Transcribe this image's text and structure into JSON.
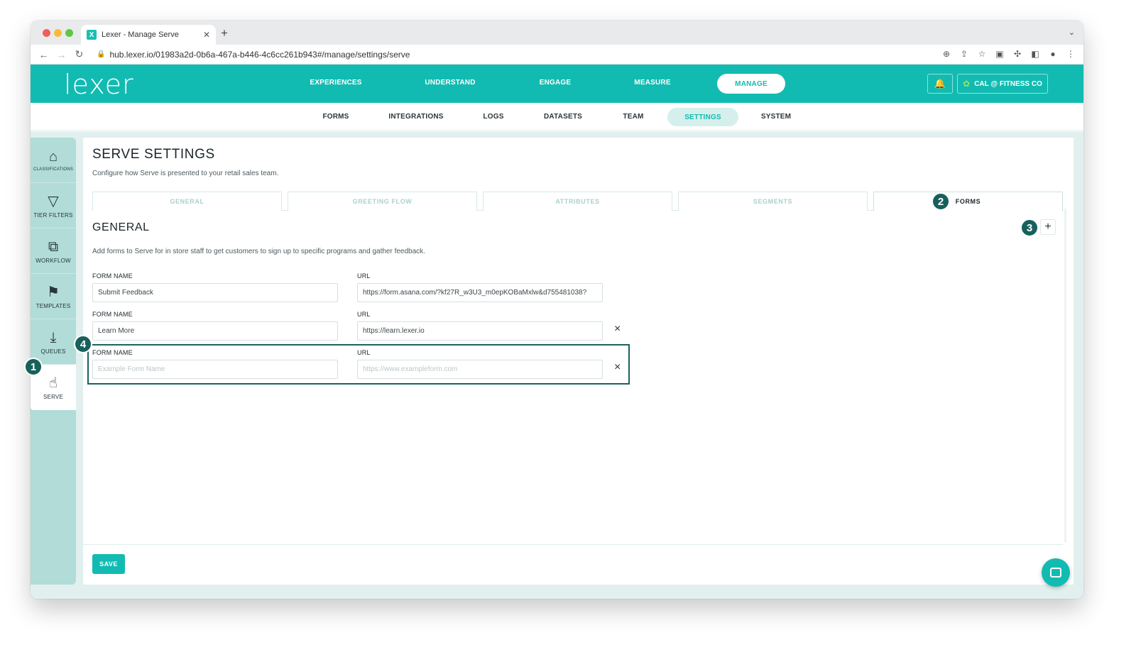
{
  "browser": {
    "tab_title": "Lexer - Manage Serve",
    "favicon_letter": "X",
    "new_tab": "+",
    "url": "hub.lexer.io/01983a2d-0b6a-467a-b446-4c6cc261b943#/manage/settings/serve"
  },
  "app": {
    "logo": "lexer",
    "main_nav": [
      "EXPERIENCES",
      "UNDERSTAND",
      "ENGAGE",
      "MEASURE",
      "MANAGE"
    ],
    "main_nav_active": "MANAGE",
    "account": "CAL @ FITNESS CO",
    "sub_nav": [
      "FORMS",
      "INTEGRATIONS",
      "LOGS",
      "DATASETS",
      "TEAM",
      "SETTINGS",
      "SYSTEM"
    ],
    "sub_nav_active": "SETTINGS",
    "accent_color": "#12bbb1"
  },
  "sidebar": {
    "items": [
      {
        "label": "CLASSIFICATIONS",
        "icon": "tag-icon"
      },
      {
        "label": "TIER FILTERS",
        "icon": "filter-icon"
      },
      {
        "label": "WORKFLOW",
        "icon": "workflow-icon"
      },
      {
        "label": "TEMPLATES",
        "icon": "bookmark-icon"
      },
      {
        "label": "QUEUES",
        "icon": "download-tray-icon"
      },
      {
        "label": "SERVE",
        "icon": "hand-icon"
      }
    ],
    "active": "SERVE"
  },
  "page": {
    "title": "SERVE SETTINGS",
    "subtitle": "Configure how Serve is presented to your retail sales team.",
    "tabs": [
      "GENERAL",
      "GREETING FLOW",
      "ATTRIBUTES",
      "SEGMENTS",
      "FORMS"
    ],
    "active_tab": "FORMS",
    "section_title": "GENERAL",
    "section_desc": "Add forms to Serve for in store staff to get customers to sign up to specific programs and gather feedback.",
    "add_label": "+",
    "form_name_label": "FORM NAME",
    "url_label": "URL",
    "forms": [
      {
        "name": "Submit Feedback",
        "url": "https://form.asana.com/?kf27R_w3U3_m0epKOBaMxlw&d755481038?"
      },
      {
        "name": "Learn More",
        "url": "https://learn.lexer.io"
      }
    ],
    "new_form": {
      "name_placeholder": "Example Form Name",
      "url_placeholder": "https://www.exampleform.com"
    },
    "remove_label": "×",
    "save_label": "SAVE"
  },
  "annotations": [
    "1",
    "2",
    "3",
    "4"
  ]
}
